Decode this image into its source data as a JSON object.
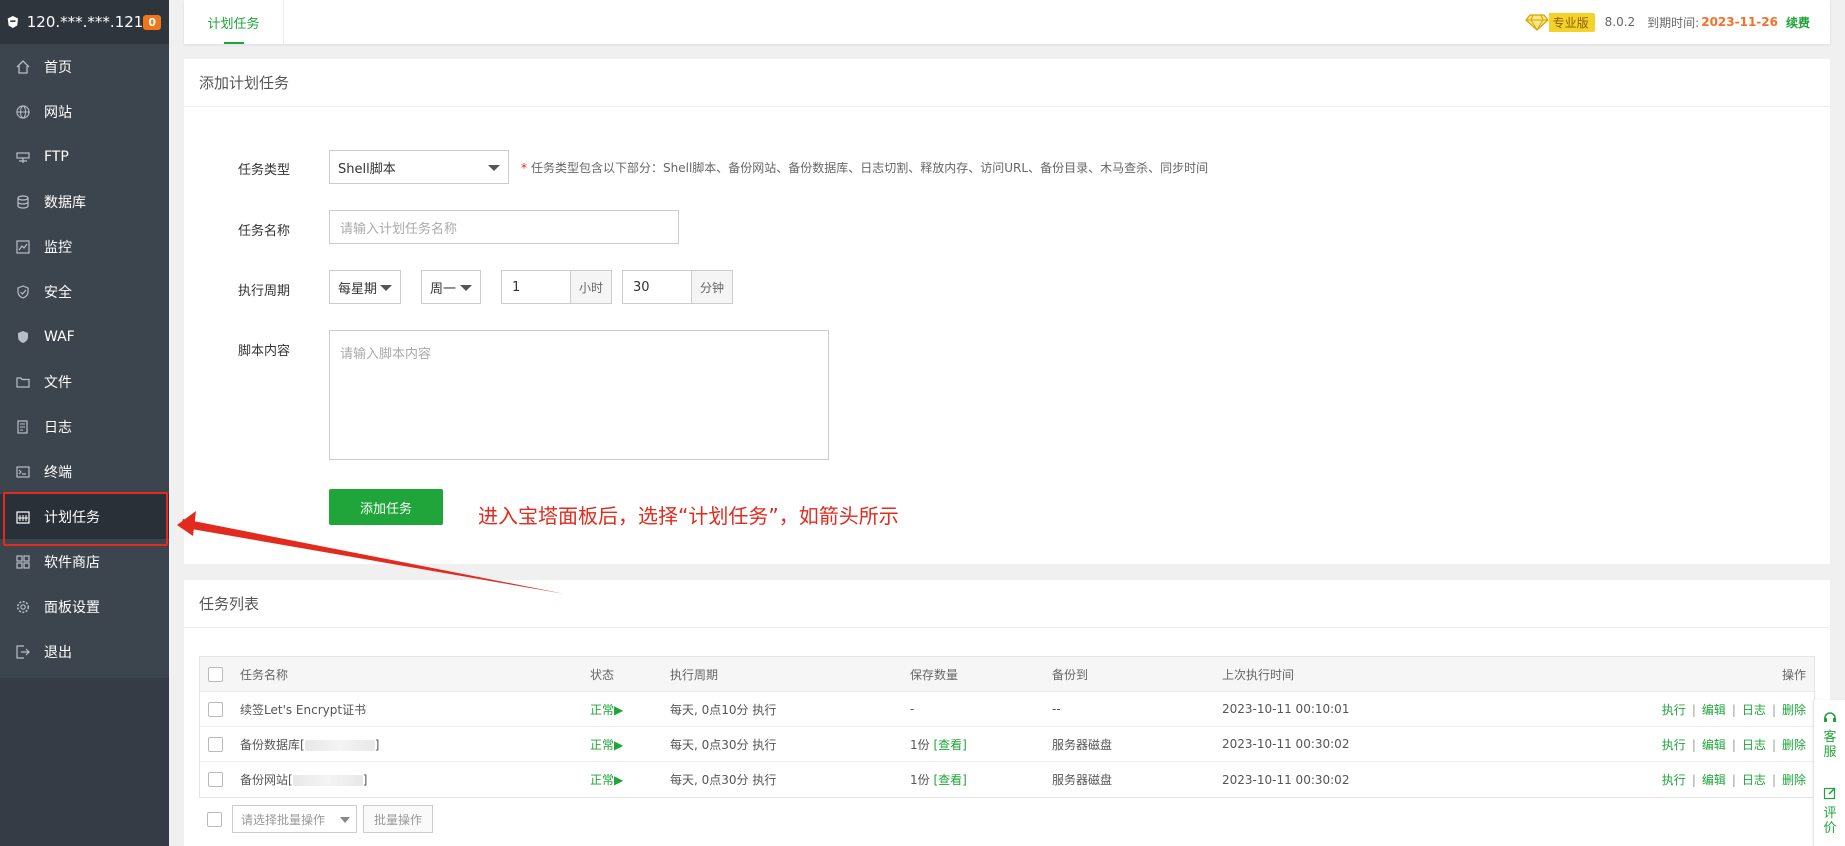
{
  "sidebar": {
    "ip": "120.***.***.121",
    "badge": "0",
    "items": [
      {
        "label": "首页",
        "icon": "home-icon"
      },
      {
        "label": "网站",
        "icon": "globe-icon"
      },
      {
        "label": "FTP",
        "icon": "ftp-icon"
      },
      {
        "label": "数据库",
        "icon": "database-icon"
      },
      {
        "label": "监控",
        "icon": "monitor-icon"
      },
      {
        "label": "安全",
        "icon": "shield-icon"
      },
      {
        "label": "WAF",
        "icon": "waf-icon"
      },
      {
        "label": "文件",
        "icon": "folder-icon"
      },
      {
        "label": "日志",
        "icon": "log-icon"
      },
      {
        "label": "终端",
        "icon": "terminal-icon"
      },
      {
        "label": "计划任务",
        "icon": "calendar-icon",
        "active": true
      },
      {
        "label": "软件商店",
        "icon": "apps-icon"
      },
      {
        "label": "面板设置",
        "icon": "gear-icon"
      },
      {
        "label": "退出",
        "icon": "logout-icon"
      }
    ]
  },
  "topbar": {
    "tab": "计划任务",
    "pro_label": "专业版",
    "version": "8.0.2",
    "expire_label": "到期时间:",
    "expire_date": "2023-11-26",
    "renew": "续费"
  },
  "form": {
    "title": "添加计划任务",
    "type_label": "任务类型",
    "type_value": "Shell脚本",
    "type_hint": "任务类型包含以下部分：Shell脚本、备份网站、备份数据库、日志切割、释放内存、访问URL、备份目录、木马查杀、同步时间",
    "name_label": "任务名称",
    "name_placeholder": "请输入计划任务名称",
    "period_label": "执行周期",
    "period_type": "每星期",
    "weekday": "周一",
    "hour": "1",
    "hour_unit": "小时",
    "minute": "30",
    "minute_unit": "分钟",
    "script_label": "脚本内容",
    "script_placeholder": "请输入脚本内容",
    "submit": "添加任务",
    "annotation": "进入宝塔面板后，选择“计划任务”，如箭头所示"
  },
  "list": {
    "title": "任务列表",
    "columns": [
      "任务名称",
      "状态",
      "执行周期",
      "保存数量",
      "备份到",
      "上次执行时间",
      "操作"
    ],
    "rows": [
      {
        "name": "续签Let's Encrypt证书",
        "status": "正常▶",
        "period": "每天, 0点10分 执行",
        "save": "-",
        "save_link": "",
        "dest": "--",
        "last": "2023-10-11 00:10:01"
      },
      {
        "name_prefix": "备份数据库[",
        "name_suffix": "]",
        "status": "正常▶",
        "period": "每天, 0点30分 执行",
        "save": "1份",
        "save_link": "[查看]",
        "dest": "服务器磁盘",
        "last": "2023-10-11 00:30:02"
      },
      {
        "name_prefix": "备份网站[",
        "name_suffix": "]",
        "status": "正常▶",
        "period": "每天, 0点30分 执行",
        "save": "1份",
        "save_link": "[查看]",
        "dest": "服务器磁盘",
        "last": "2023-10-11 00:30:02"
      }
    ],
    "ops": [
      "执行",
      "编辑",
      "日志",
      "删除"
    ],
    "batch_placeholder": "请选择批量操作",
    "batch_button": "批量操作"
  },
  "float": {
    "service": "客服",
    "review": "评价"
  },
  "colors": {
    "accent": "#20a53a",
    "annotation": "#e22a1e",
    "sidebar_bg": "#3c444d"
  }
}
